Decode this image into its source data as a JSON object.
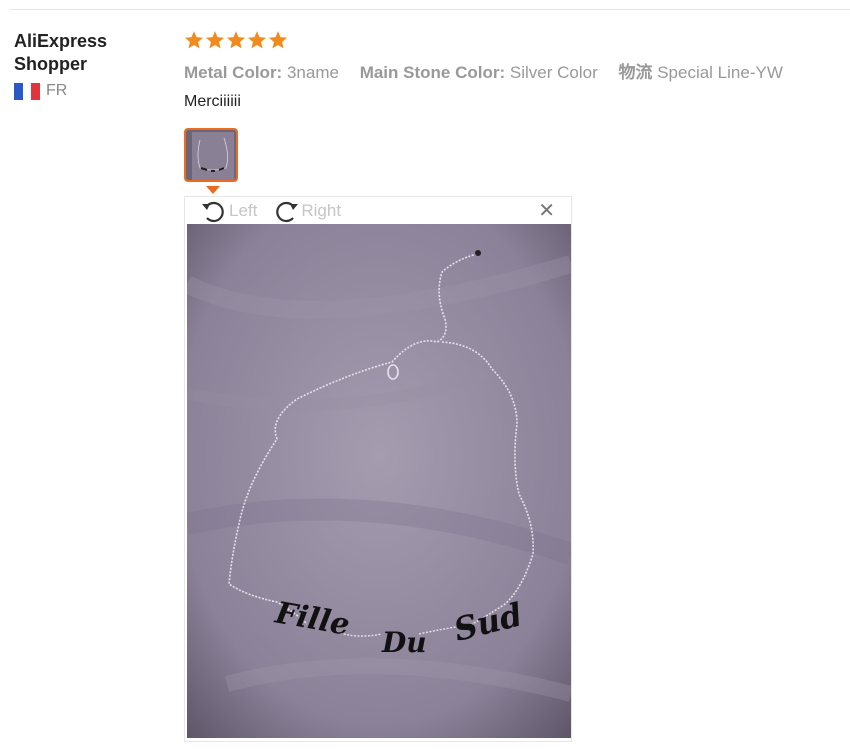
{
  "reviewer": {
    "name": "AliExpress Shopper",
    "country_code": "FR",
    "flag_colors": [
      "#2a58c8",
      "#ffffff",
      "#e0353c"
    ]
  },
  "review": {
    "rating": 5,
    "rating_max": 5,
    "star_color": "#f28b1d",
    "attributes": [
      {
        "key": "Metal Color:",
        "value": "3name"
      },
      {
        "key": "Main Stone Color:",
        "value": "Silver Color"
      },
      {
        "key": "物流",
        "value": "Special Line-YW"
      }
    ],
    "comment": "Merciiiiii"
  },
  "viewer": {
    "rotate_left_label": "Left",
    "rotate_right_label": "Right",
    "close_icon": "close-icon",
    "photo_text": [
      "Fille",
      "Du",
      "Sud"
    ],
    "accent_color": "#ec6b1f"
  }
}
